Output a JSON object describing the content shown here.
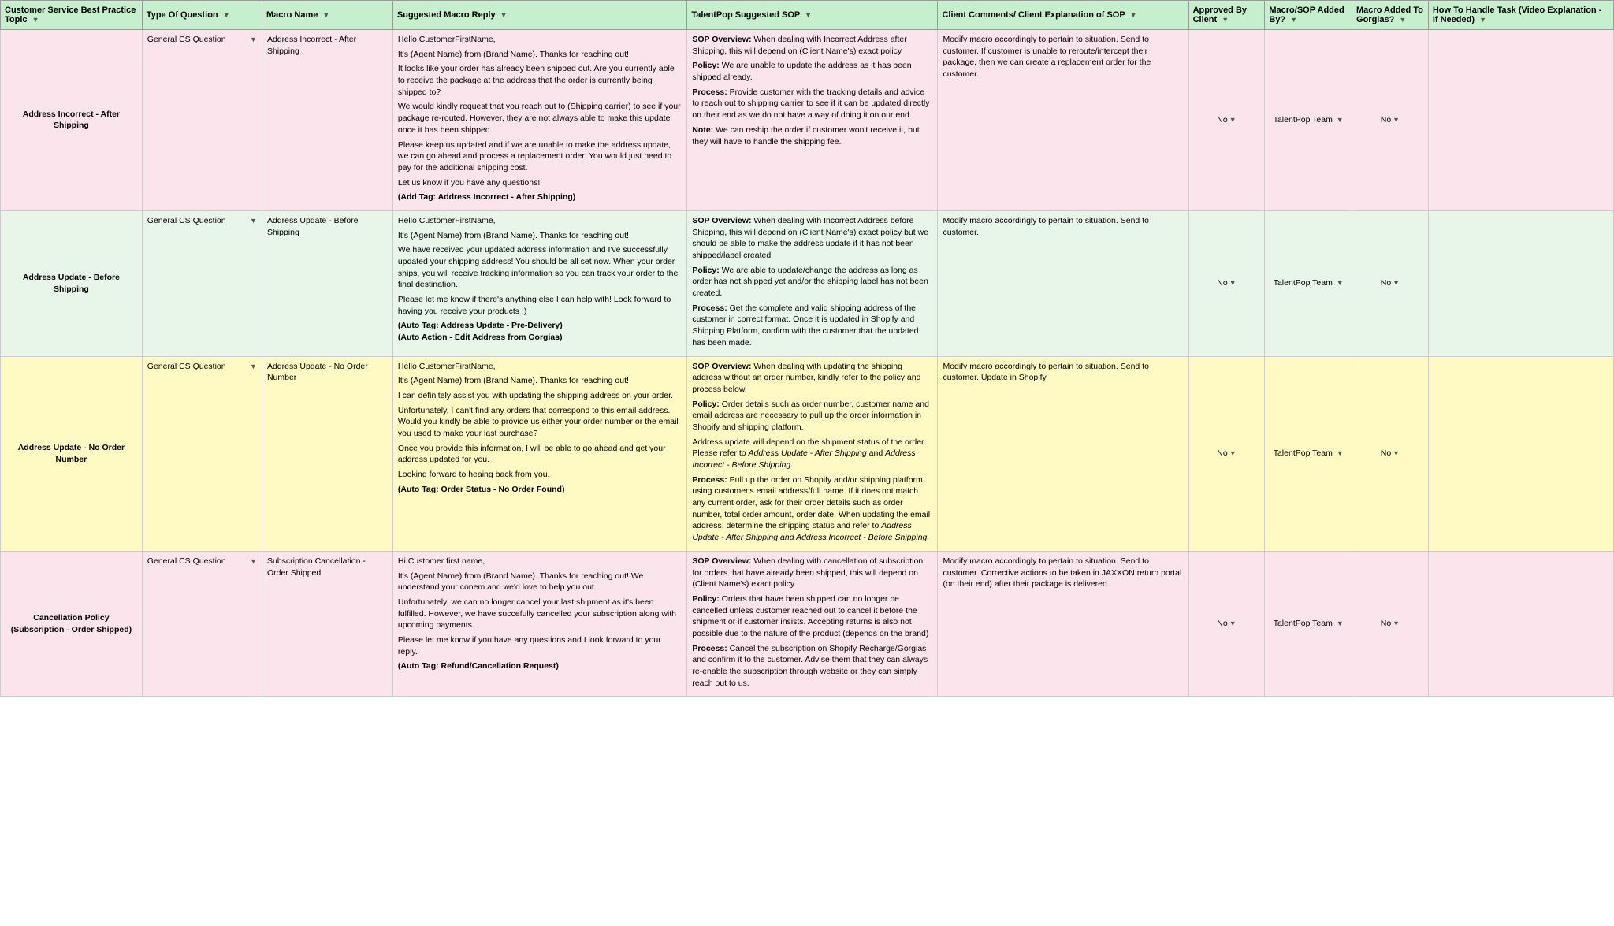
{
  "table": {
    "headers": [
      {
        "label": "Customer Service Best Practice Topic",
        "key": "topic"
      },
      {
        "label": "Type Of Question",
        "key": "type"
      },
      {
        "label": "Macro Name",
        "key": "name"
      },
      {
        "label": "Suggested Macro Reply",
        "key": "reply"
      },
      {
        "label": "TalentPop Suggested SOP",
        "key": "sop"
      },
      {
        "label": "Client Comments/ Client Explanation of SOP",
        "key": "comments"
      },
      {
        "label": "Approved By Client",
        "key": "approved"
      },
      {
        "label": "Macro/SOP Added By?",
        "key": "addedby"
      },
      {
        "label": "Macro Added To Gorgias?",
        "key": "macro"
      },
      {
        "label": "How To Handle Task (Video Explanation - If Needed)",
        "key": "howto"
      }
    ],
    "rows": [
      {
        "group": 1,
        "topic": "Address Incorrect - After Shipping",
        "type": "General CS Question",
        "name": "Address Incorrect - After Shipping",
        "reply": "Hello CustomerFirstName,\n\nIt's (Agent Name) from (Brand Name). Thanks for reaching out!\n\nIt looks like your order has already been shipped out. Are you currently able to receive the package at the address that the order is currently being shipped to?\n\nWe would kindly request that you reach out to (Shipping carrier) to see if your package re-routed. However, they are not always able to make this update once it has been shipped.\n\nPlease keep us updated and if we are unable to make the address update, we can go ahead and process a replacement order. You would just need to pay for the additional shipping cost.\n\nLet us know if you have any questions!\n\n(Add Tag: Address Incorrect - After Shipping)",
        "sop": "SOP Overview: When dealing with Incorrect Address after Shipping, this will depend on (Client Name's) exact policy\n\nPolicy: We are unable to update the address as it has been shipped already.\n\nProcess: Provide customer with the tracking details and advice to reach out to shipping carrier to see if it can be updated directly on their end as we do not have a way of doing it on our end.\n\nNote: We can reship the order if customer won't receive it, but they will have to handle the shipping fee.",
        "comments": "Modify macro accordingly to pertain to situation. Send to customer. If customer is unable to reroute/intercept their package, then we can create a replacement order for the customer.",
        "approved": "No",
        "addedby": "TalentPop Team",
        "macro": "No",
        "howto": ""
      },
      {
        "group": 2,
        "topic": "Address Update - Before Shipping",
        "type": "General CS Question",
        "name": "Address Update - Before Shipping",
        "reply": "Hello CustomerFirstName,\n\nIt's (Agent Name) from (Brand Name). Thanks for reaching out!\n\nWe have received your updated address information and I've successfully updated your shipping address! You should be all set now. When your order ships, you will receive tracking information so you can track your order to the final destination.\n\nPlease let me know if there's anything else I can help with! Look forward to having you receive your products :)\n\n(Auto Tag: Address Update - Pre-Delivery)\n(Auto Action - Edit Address from Gorgias)",
        "sop": "SOP Overview: When dealing with Incorrect Address before Shipping, this will depend on (Client Name's) exact policy but we should be able to make the address update if it has not been shipped/label created\n\nPolicy: We are able to update/change the address as long as order has not shipped yet and/or the shipping label has not been created.\n\nProcess: Get the complete and valid shipping address of the customer in correct format. Once it is updated in Shopify and Shipping Platform, confirm with the customer that the updated has been made.",
        "comments": "Modify macro accordingly to pertain to situation. Send to customer.",
        "approved": "No",
        "addedby": "TalentPop Team",
        "macro": "No",
        "howto": ""
      },
      {
        "group": 3,
        "topic": "Address Update - No Order Number",
        "type": "General CS Question",
        "name": "Address Update - No Order Number",
        "reply": "Hello CustomerFirstName,\n\nIt's (Agent Name) from (Brand Name). Thanks for reaching out!\n\nI can definitely assist you with updating the shipping address on your order.\n\nUnfortunately, I can't find any orders that correspond to this email address. Would you kindly be able to provide us either your order number or the email you used to make your last purchase?\n\nOnce you provide this information, I will be able to go ahead and get your address updated for you.\n\nLooking forward to heaing back from you.\n\n(Auto Tag: Order Status - No Order Found)",
        "sop": "SOP Overview: When dealing with updating the shipping address without an order number, kindly refer to the policy and process below.\n\nPolicy: Order details such as order number, customer name and email address are necessary to pull up the order information in Shopify and shipping platform.\n\nAddress update will depend on the shipment status of the order. Please refer to Address Update - After Shipping and Address Incorrect - Before Shipping.\n\nProcess: Pull up the order on Shopify and/or shipping platform using customer's email address/full name. If it does not match any current order, ask for their order details such as order number, total order amount, order date. When updating the email address, determine the shipping status and refer to Address Update - After Shipping and Address Incorrect - Before Shipping.",
        "comments": "Modify macro accordingly to pertain to situation. Send to customer. Update in Shopify",
        "approved": "No",
        "addedby": "TalentPop Team",
        "macro": "No",
        "howto": ""
      },
      {
        "group": 4,
        "topic": "Cancellation Policy (Subscription - Order Shipped)",
        "type": "General CS Question",
        "name": "Subscription Cancellation - Order Shipped",
        "reply": "Hi Customer first name,\n\nIt's (Agent Name) from (Brand Name). Thanks for reaching out! We understand your conem and we'd love to help you out.\n\nUnfortunately, we can no longer cancel your last shipment as it's been fulfilled. However, we have succefully cancelled your subscription along with upcoming payments.\n\nPlease let me know if you have any questions and I look forward to your reply.\n\n(Auto Tag: Refund/Cancellation Request)",
        "sop": "SOP Overview: When dealing with cancellation of subscription for orders that have already been shipped, this will depend on (Client Name's) exact policy.\n\nPolicy: Orders that have been shipped can no longer be cancelled unless customer reached out to cancel it before the shipment or if customer insists. Accepting returns is also not possible due to the nature of the product (depends on the brand)\n\nProcess: Cancel the subscription on Shopify Recharge/Gorgias and confirm it to the customer. Advise them that they can always re-enable the subscription through website or they can simply reach out to us.",
        "comments": "Modify macro accordingly to pertain to situation. Send to customer. Corrective actions to be taken in JAXXON return portal (on their end) after their package is delivered.",
        "approved": "No",
        "addedby": "TalentPop Team",
        "macro": "No",
        "howto": ""
      }
    ]
  }
}
